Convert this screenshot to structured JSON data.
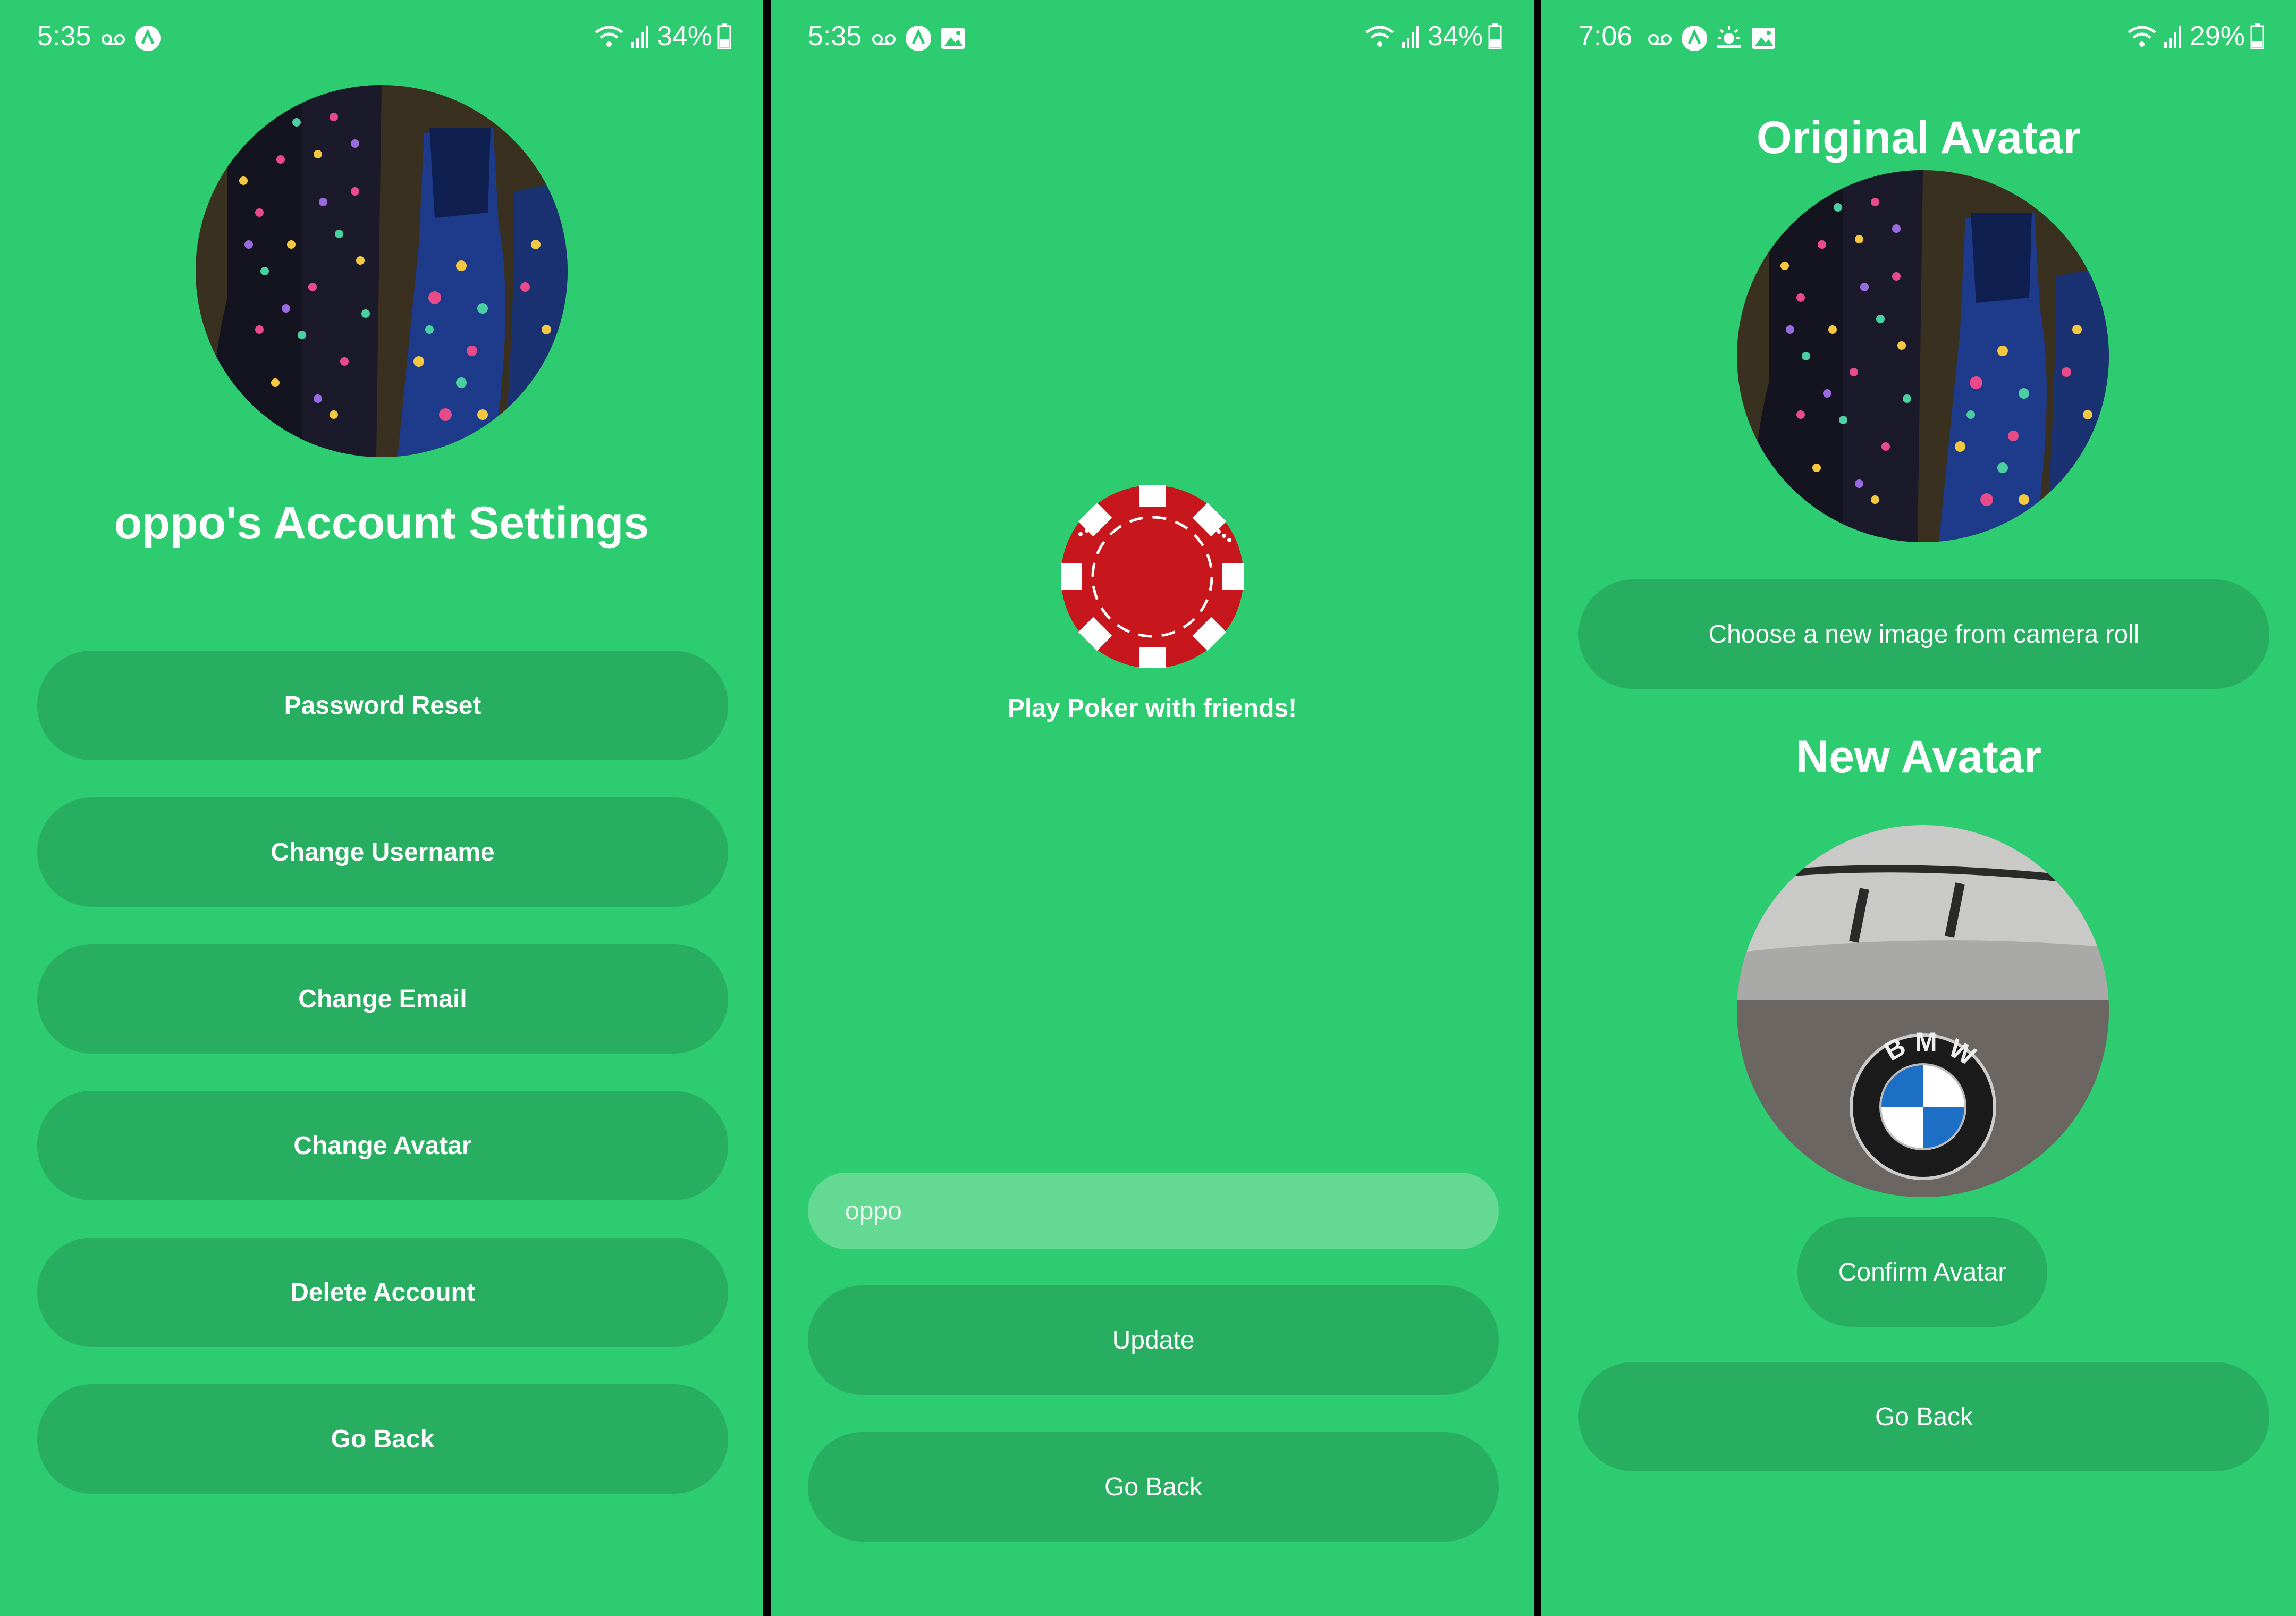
{
  "screens": [
    {
      "status": {
        "time": "5:35",
        "battery": "34%"
      },
      "avatar_alt": "polka dot rain boots",
      "title": "oppo's Account Settings",
      "buttons": [
        "Password Reset",
        "Change Username",
        "Change Email",
        "Change Avatar",
        "Delete Account",
        "Go Back"
      ]
    },
    {
      "status": {
        "time": "5:35",
        "battery": "34%"
      },
      "tagline": "Play Poker with friends!",
      "username_input": {
        "value": "",
        "placeholder": "oppo"
      },
      "update_label": "Update",
      "back_label": "Go Back"
    },
    {
      "status": {
        "time": "7:06",
        "battery": "29%"
      },
      "original_title": "Original Avatar",
      "choose_label": "Choose a new image from camera roll",
      "new_title": "New Avatar",
      "confirm_label": "Confirm Avatar",
      "back_label": "Go Back"
    }
  ],
  "colors": {
    "background": "#2ecc71",
    "button": "#27ae60",
    "input": "#63d994",
    "chip_red": "#c8161d"
  },
  "icons": [
    "voicemail-icon",
    "app-a-icon",
    "gallery-icon",
    "weather-icon",
    "wifi-icon",
    "signal-icon",
    "battery-icon",
    "poker-chip-icon"
  ]
}
